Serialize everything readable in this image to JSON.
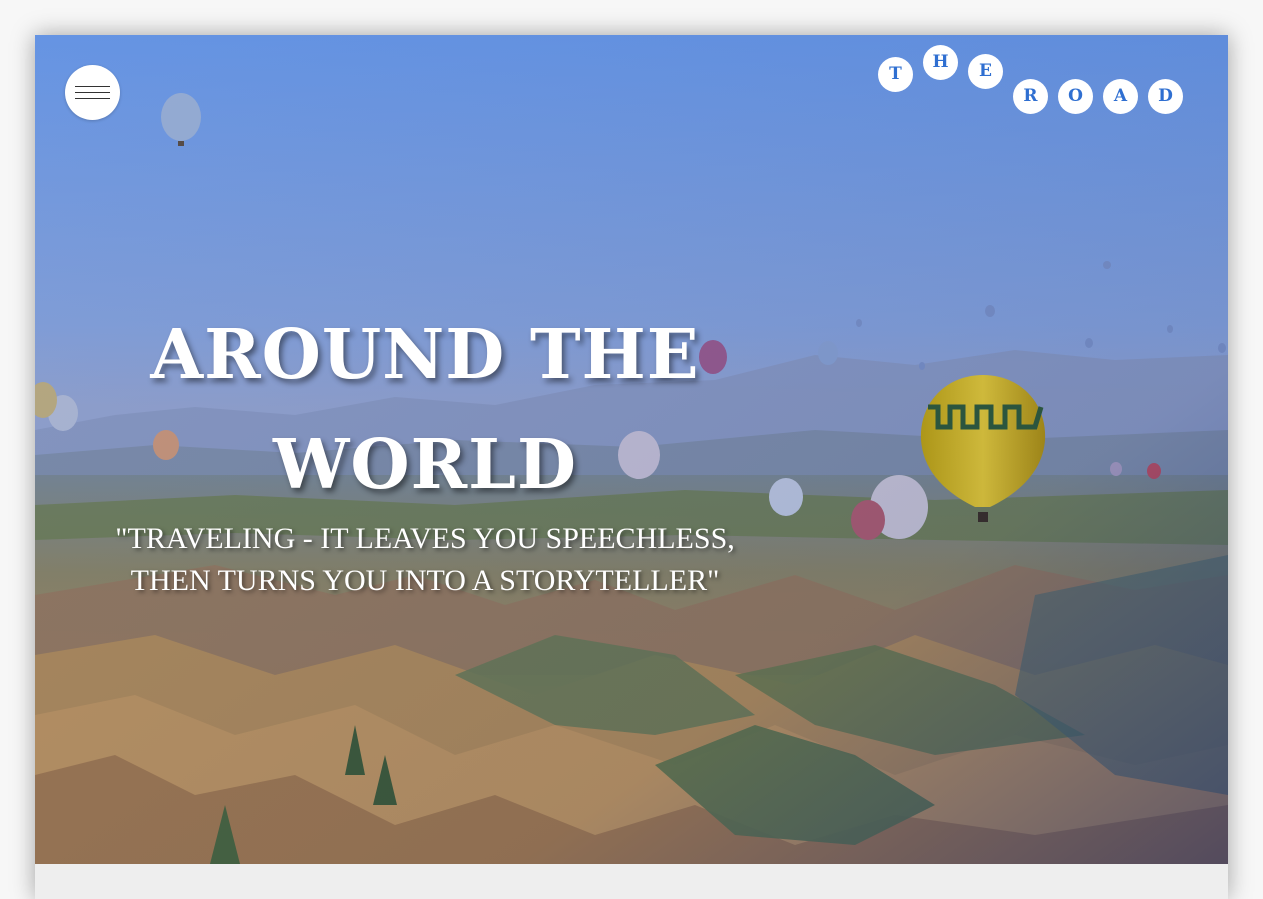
{
  "header": {
    "menu_button_label": "menu",
    "logo_letters": [
      "T",
      "H",
      "E",
      "R",
      "O",
      "A",
      "D"
    ]
  },
  "hero": {
    "title_line1": "AROUND THE",
    "title_line2": "WORLD",
    "quote_line1": "\"TRAVELING - IT LEAVES YOU SPEECHLESS,",
    "quote_line2": "THEN TURNS YOU INTO A STORYTELLER\""
  },
  "colors": {
    "accent": "#2f6fd1",
    "sky_top": "#6b9be6",
    "overlay": "#3a5fb8"
  },
  "icons": {
    "menu": "hamburger-icon"
  }
}
